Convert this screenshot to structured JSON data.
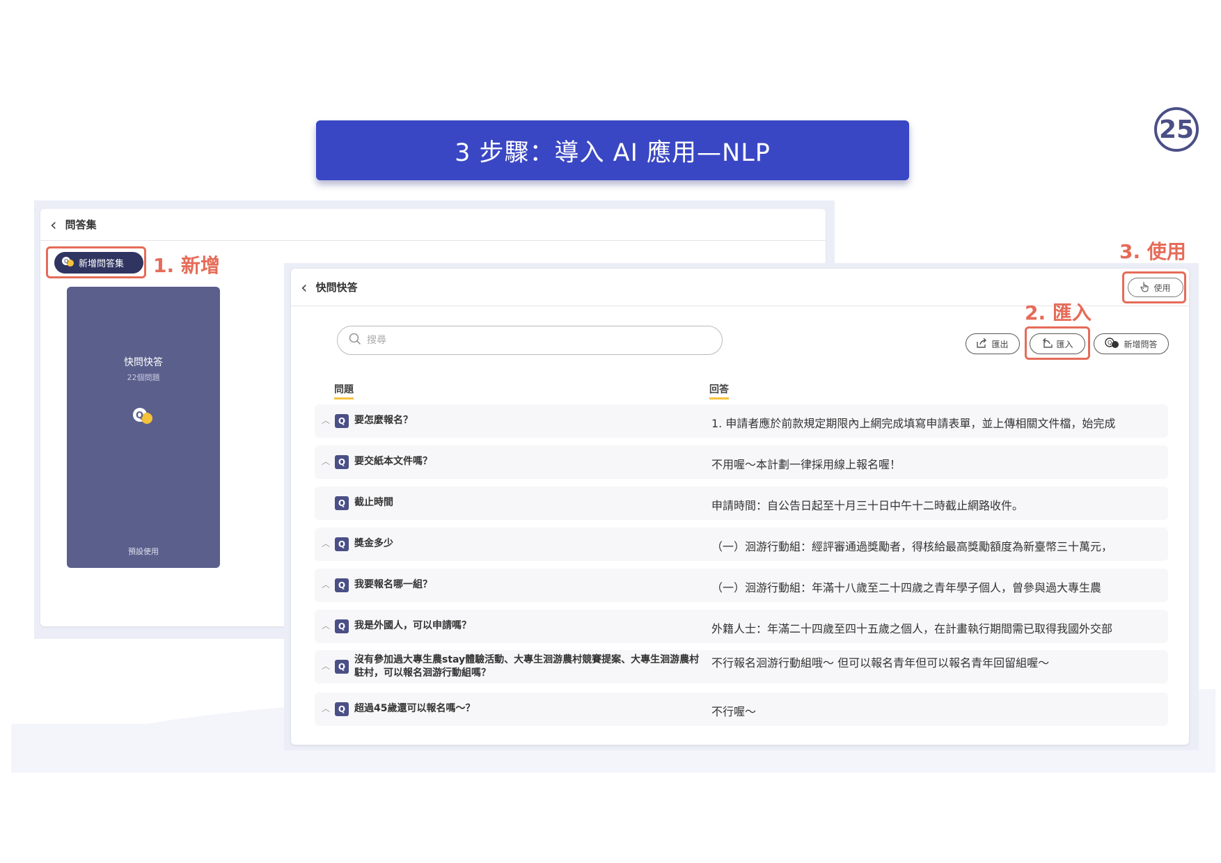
{
  "slide": {
    "title": "3 步驟：導入 AI 應用—NLP",
    "page_number": "25"
  },
  "annotations": {
    "step1": "1. 新增",
    "step2": "2. 匯入",
    "step3": "3. 使用",
    "highlight_color": "#e56b58"
  },
  "left_panel": {
    "header_title": "問答集",
    "new_set_button": "新增問答集",
    "card": {
      "title": "快問快答",
      "count": "22個問題",
      "footer": "預設使用"
    }
  },
  "right_panel": {
    "header_title": "快問快答",
    "use_button": "使用",
    "search_placeholder": "搜尋",
    "export_button": "匯出",
    "import_button": "匯入",
    "add_qa_button": "新增問答",
    "columns": {
      "question": "問題",
      "answer": "回答"
    },
    "badge": "Q",
    "rows": [
      {
        "q": "要怎麼報名？",
        "a": "1. 申請者應於前款規定期限內上網完成填寫申請表單，並上傳相關文件檔，始完成"
      },
      {
        "q": "要交紙本文件嗎？",
        "a": "不用喔～本計劃一律採用線上報名喔！"
      },
      {
        "q": "截止時間",
        "a": "申請時間：自公告日起至十月三十日中午十二時截止網路收件。"
      },
      {
        "q": "獎金多少",
        "a": "（一）洄游行動組：經評審通過獎勵者，得核給最高獎勵額度為新臺幣三十萬元，"
      },
      {
        "q": "我要報名哪一組？",
        "a": "（一）洄游行動組：年滿十八歲至二十四歲之青年學子個人，曾參與過大專生農"
      },
      {
        "q": "我是外國人，可以申請嗎？",
        "a": "外籍人士：年滿二十四歲至四十五歲之個人，在計畫執行期間需已取得我國外交部"
      },
      {
        "q": "沒有參加過大專生農stay體驗活動、大專生洄游農村競賽提案、大專生洄游農村駐村，可以報名洄游行動組嗎？",
        "a": "不行報名洄游行動組哦～ 但可以報名青年但可以報名青年回留組喔～"
      },
      {
        "q": "超過45歲還可以報名嗎～？",
        "a": "不行喔～"
      }
    ]
  },
  "colors": {
    "banner": "#3a47c4",
    "card": "#5b5f8c",
    "badge": "#4a4f86",
    "underline": "#f4c23b"
  }
}
